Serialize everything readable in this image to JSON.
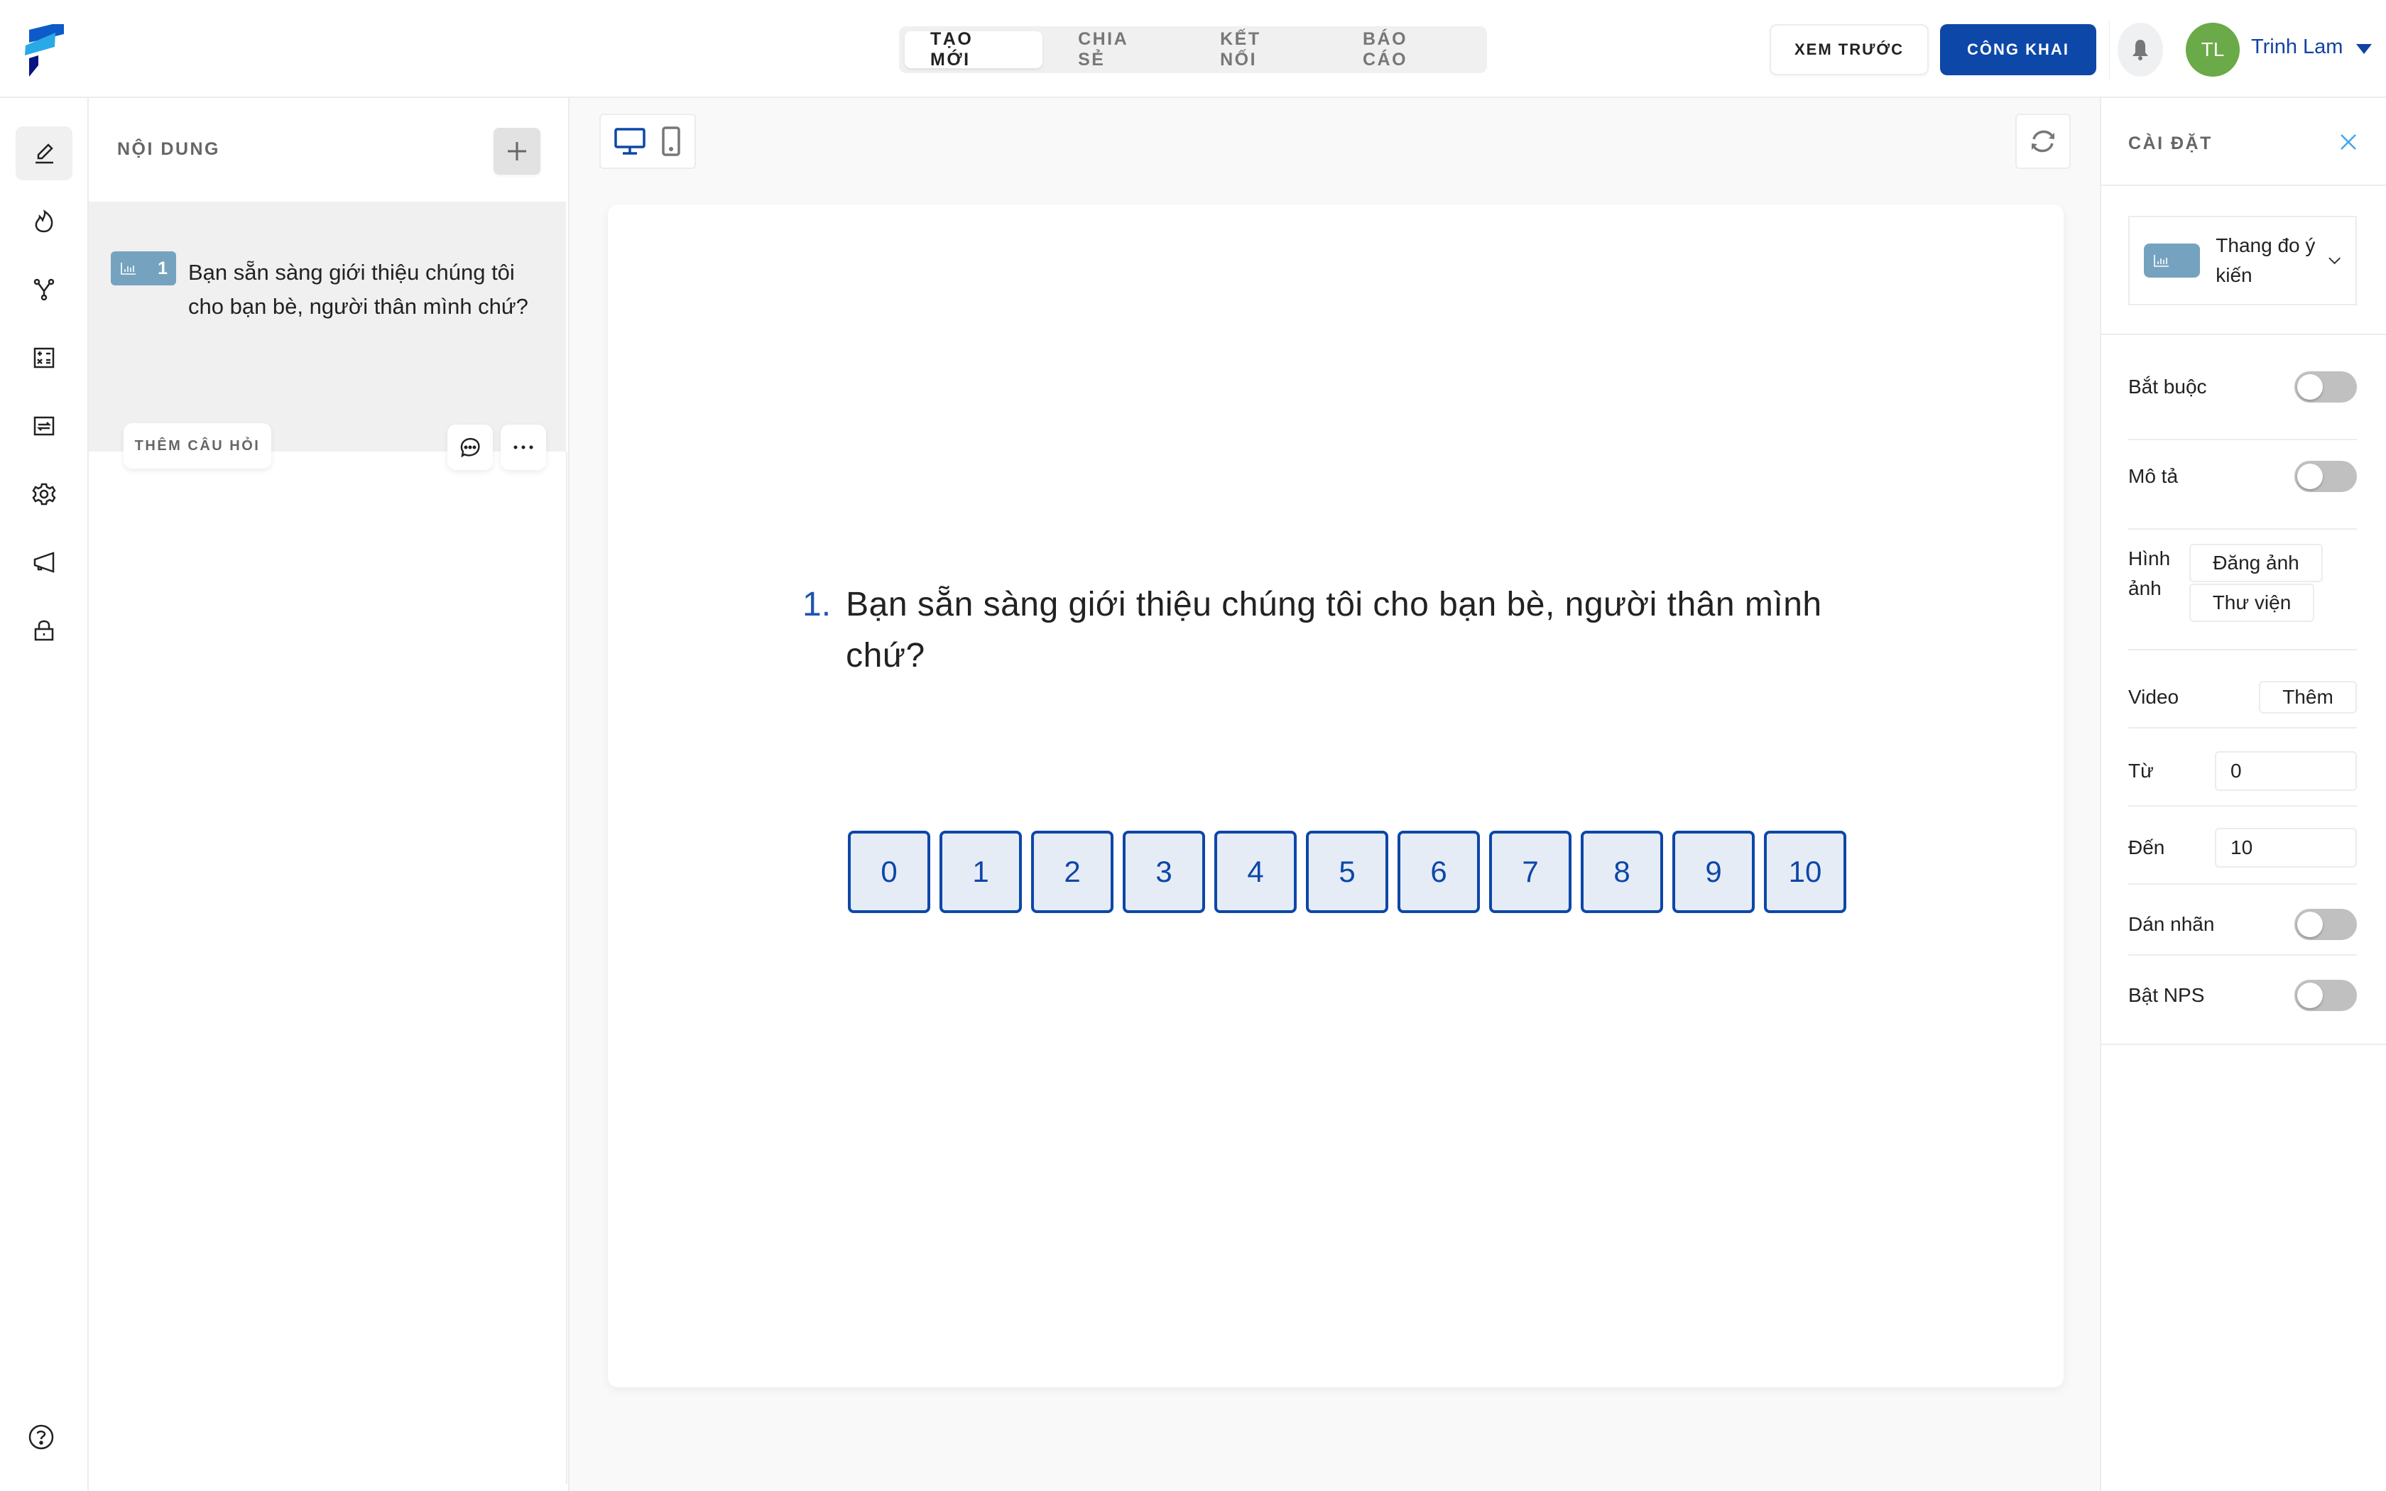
{
  "header": {
    "tabs": [
      {
        "label": "TẠO MỚI",
        "active": true
      },
      {
        "label": "CHIA SẺ",
        "active": false
      },
      {
        "label": "KẾT NỐI",
        "active": false
      },
      {
        "label": "BÁO CÁO",
        "active": false
      }
    ],
    "preview_label": "XEM TRƯỚC",
    "publish_label": "CÔNG KHAI",
    "user": {
      "initials": "TL",
      "name": "Trinh Lam"
    },
    "brand_color": "#0d47a8",
    "avatar_color": "#6aaa48"
  },
  "rail": {
    "items": [
      {
        "icon": "pencil-icon",
        "active": true
      },
      {
        "icon": "flame-icon",
        "active": false
      },
      {
        "icon": "branch-icon",
        "active": false
      },
      {
        "icon": "calculator-icon",
        "active": false
      },
      {
        "icon": "repeat-icon",
        "active": false
      },
      {
        "icon": "gear-icon",
        "active": false
      },
      {
        "icon": "megaphone-icon",
        "active": false
      },
      {
        "icon": "lock-icon",
        "active": false
      }
    ],
    "help_icon": "help-circle-icon"
  },
  "content_panel": {
    "title": "NỘI DUNG",
    "questions": [
      {
        "number": "1",
        "type_icon": "bar-chart-icon",
        "text": "Bạn sẵn sàng giới thiệu chúng tôi cho bạn bè, người thân mình chứ?"
      }
    ],
    "add_question_label": "THÊM CÂU HỎI"
  },
  "canvas": {
    "device_modes": [
      {
        "icon": "desktop-icon",
        "active": true
      },
      {
        "icon": "mobile-icon",
        "active": false
      }
    ],
    "question": {
      "number": "1.",
      "title": "Bạn sẵn sàng giới thiệu chúng tôi cho bạn bè, người thân mình chứ?",
      "scale_options": [
        "0",
        "1",
        "2",
        "3",
        "4",
        "5",
        "6",
        "7",
        "8",
        "9",
        "10"
      ]
    }
  },
  "settings": {
    "title": "CÀI ĐẶT",
    "question_type": "Thang đo ý kiến",
    "required_label": "Bắt buộc",
    "required_on": false,
    "description_label": "Mô tả",
    "description_on": false,
    "image_label": "Hình ảnh",
    "upload_image_label": "Đăng ảnh",
    "library_label": "Thư viện",
    "video_label": "Video",
    "video_add_label": "Thêm",
    "from_label": "Từ",
    "from_value": "0",
    "to_label": "Đến",
    "to_value": "10",
    "labels_label": "Dán nhãn",
    "labels_on": false,
    "nps_label": "Bật NPS",
    "nps_on": false
  }
}
